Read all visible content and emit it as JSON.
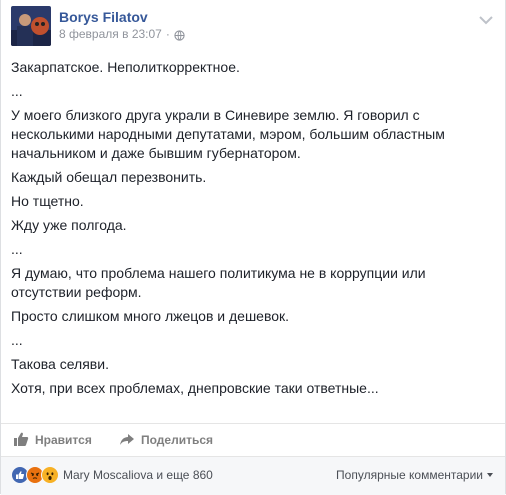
{
  "post": {
    "author": "Borys Filatov",
    "timestamp": "8 февраля в 23:07",
    "separator": "·",
    "privacy_icon": "globe-icon",
    "paragraphs": [
      "Закарпатское. Неполиткорректное.",
      "...",
      "У моего близкого друга украли в Синевире землю. Я говорил с несколькими народными депутатами, мэром, большим областным начальником и даже бывшим губернатором.",
      "Каждый обещал перезвонить.",
      "Но тщетно.",
      "Жду уже полгода.",
      "...",
      "Я думаю, что проблема нашего политикума не в коррупции или отсутствии реформ.",
      "Просто слишком много лжецов и дешевок.",
      "...",
      "Такова селяви.",
      "Хотя, при всех проблемах, днепровские таки ответные..."
    ]
  },
  "actions": {
    "like_label": "Нравится",
    "share_label": "Поделиться"
  },
  "reactions": {
    "summary": "Mary Moscaliova и еще 860",
    "sort_label": "Популярные комментарии",
    "types": [
      "like",
      "angry",
      "wow"
    ],
    "colors": {
      "like": "#4267b2",
      "angry": "#e9710f",
      "wow": "#f7b125"
    }
  }
}
